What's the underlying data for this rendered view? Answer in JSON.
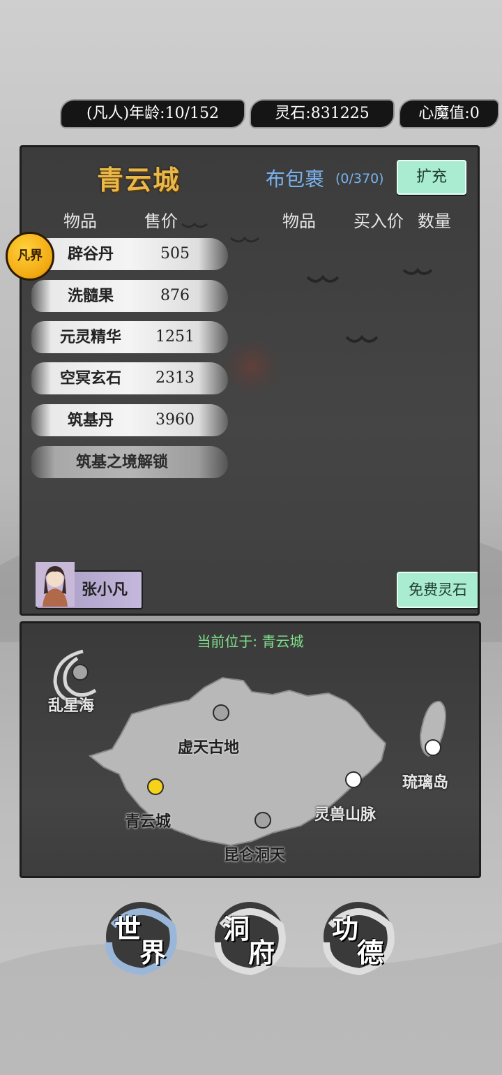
{
  "status": {
    "age": "(凡人)年龄:10/152",
    "spirit_stone": "灵石:831225",
    "demon_value": "心魔值:0"
  },
  "shop": {
    "city_title": "青云城",
    "bag_label": "布包裹",
    "bag_count": "(0/370)",
    "expand_label": "扩充",
    "left_headers": {
      "item": "物品",
      "price": "售价"
    },
    "right_headers": {
      "item": "物品",
      "buy_price": "买入价",
      "quantity": "数量"
    },
    "items": [
      {
        "name": "辟谷丹",
        "price": "505"
      },
      {
        "name": "洗髓果",
        "price": "876"
      },
      {
        "name": "元灵精华",
        "price": "1251"
      },
      {
        "name": "空冥玄石",
        "price": "2313"
      },
      {
        "name": "筑基丹",
        "price": "3960"
      }
    ],
    "locked_label": "筑基之境解锁",
    "realm_badge": "凡界",
    "character_name": "张小凡",
    "free_stone_label": "免费灵石"
  },
  "map": {
    "current_location": "当前位于: 青云城",
    "places": {
      "luanxing": "乱星海",
      "xutian": "虚天古地",
      "qingyun": "青云城",
      "kunlun": "昆仑洞天",
      "lingshou": "灵兽山脉",
      "liuli": "琉璃岛"
    }
  },
  "nav": {
    "world": [
      "世",
      "界"
    ],
    "cave": [
      "洞",
      "府"
    ],
    "merit": [
      "功",
      "德"
    ]
  },
  "colors": {
    "title_gold": "#e8b84a",
    "bag_blue": "#79b2ee",
    "mint_button": "#a9ecd2",
    "location_green": "#7fe08a",
    "current_dot": "#f6d21a"
  }
}
